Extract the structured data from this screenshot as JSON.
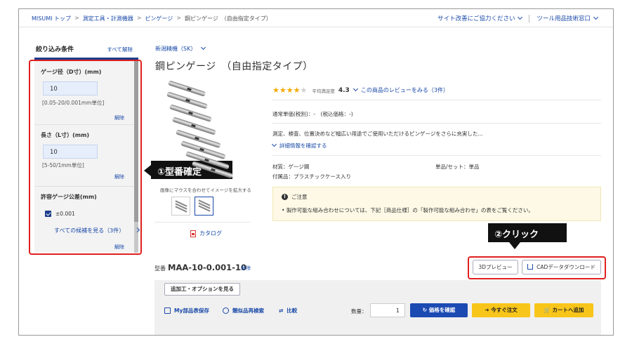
{
  "breadcrumb": {
    "items": [
      "MISUMI トップ",
      "測定工具・計測機器",
      "ピンゲージ",
      "鋼ピンゲージ　（自由指定タイプ）"
    ],
    "separator": ">"
  },
  "header_links": {
    "feedback": "サイト改善にご協力ください",
    "tools_help": "ツール用品技術窓口"
  },
  "sidebar": {
    "title": "絞り込み条件",
    "clear_all": "すべて解除",
    "filters": [
      {
        "label": "ゲージ径（D寸）(mm)",
        "value": "10",
        "hint": "[0.05-20/0.001mm単位]",
        "reset": "解除"
      },
      {
        "label": "長さ（L寸）(mm)",
        "value": "10",
        "hint": "[5-50/1mm単位]",
        "reset": "解除"
      }
    ],
    "tolerance": {
      "label": "許容ゲージ公差(mm)",
      "option": "±0.001",
      "see_all": "すべての候補を見る（3件）",
      "reset": "解除"
    }
  },
  "product": {
    "maker": "新潟精機（SK）",
    "title": "鋼ピンゲージ　（自由指定タイプ）",
    "rating_value": 4.3,
    "stars_filled": 4,
    "stars_total": 5,
    "rating_label": "平均満足度",
    "rating_number": "4.3",
    "review_link": "この商品のレビューをみる（3件）",
    "price": "通常単価(税別)：-　(税込価格：-)",
    "description": "測定、検査、位置決めなど幅広い用途でご使用いただけるピンゲージをさらに充実した...",
    "details_link": "詳細情報を確認する",
    "material": "材質：ゲージ鋼",
    "unit": "単品/セット：単品",
    "accessory": "付属品：プラスチックケース入り",
    "notice_title": "ご注意",
    "notice_body": "製作可能な組み合わせについては、下記［商品仕様］の「製作可能な組み合わせ」の表をご覧ください。"
  },
  "gallery": {
    "hover_note": "画像にマウスを合わせてイメージを拡大する",
    "catalog": "カタログ"
  },
  "callouts": {
    "step1": "①型番確定",
    "step2": "②クリック"
  },
  "part_number": {
    "label": "型番",
    "value": "MAA-10-0.001-10",
    "reset": "解除",
    "preview_3d": "3Dプレビュー",
    "cad_download": "CADデータダウンロード"
  },
  "actions": {
    "options": "追加工・オプションを見る",
    "my_parts": "My部品表保存",
    "similar": "類似品再検索",
    "compare": "比較",
    "qty_label": "数量：",
    "qty_value": "1",
    "confirm_price": "価格を確認",
    "order_now": "今すぐ注文",
    "add_cart": "カートへ追加"
  },
  "colors": {
    "link": "#1a4aa8",
    "accent_navy": "#1c3c8c",
    "callout_red": "#e02020",
    "primary_blue": "#1c4ab3",
    "cta_yellow": "#f8c51b",
    "star": "#f5a800"
  }
}
